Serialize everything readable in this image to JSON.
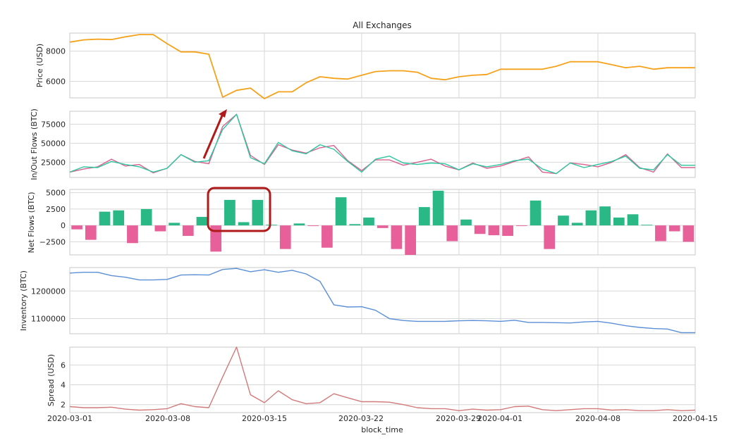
{
  "figure": {
    "title": "All Exchanges",
    "xlabel": "block_time",
    "x_ticks": [
      "2020-03-01",
      "2020-03-08",
      "2020-03-15",
      "2020-03-22",
      "2020-03-29",
      "2020-04-01",
      "2020-04-08",
      "2020-04-15"
    ],
    "colors": {
      "price": "#f5a21a",
      "inflow": "#d9608e",
      "outflow": "#2cc6a0",
      "net_positive": "#2ab887",
      "net_negative": "#e8609a",
      "inventory": "#5b8fd6",
      "spread": "#d17a7a",
      "annotation": "#b01a1a",
      "grid": "#d7d7d7"
    }
  },
  "chart_data": [
    {
      "type": "line",
      "ylabel": "Price (USD)",
      "ylim": [
        4900,
        9200
      ],
      "yticks": [
        6000,
        8000
      ],
      "ytick_labels": [
        "6000",
        "8000"
      ],
      "x": [
        "2020-03-01",
        "2020-03-02",
        "2020-03-03",
        "2020-03-04",
        "2020-03-05",
        "2020-03-06",
        "2020-03-07",
        "2020-03-08",
        "2020-03-09",
        "2020-03-10",
        "2020-03-11",
        "2020-03-12",
        "2020-03-13",
        "2020-03-14",
        "2020-03-15",
        "2020-03-16",
        "2020-03-17",
        "2020-03-18",
        "2020-03-19",
        "2020-03-20",
        "2020-03-21",
        "2020-03-22",
        "2020-03-23",
        "2020-03-24",
        "2020-03-25",
        "2020-03-26",
        "2020-03-27",
        "2020-03-28",
        "2020-03-29",
        "2020-03-30",
        "2020-03-31",
        "2020-04-01",
        "2020-04-02",
        "2020-04-03",
        "2020-04-04",
        "2020-04-05",
        "2020-04-06",
        "2020-04-07",
        "2020-04-08",
        "2020-04-09",
        "2020-04-10",
        "2020-04-11",
        "2020-04-12",
        "2020-04-13",
        "2020-04-14",
        "2020-04-15"
      ],
      "series": [
        {
          "values": [
            8600,
            8750,
            8800,
            8770,
            8950,
            9100,
            9100,
            8500,
            7950,
            7950,
            7800,
            4950,
            5400,
            5550,
            4850,
            5300,
            5300,
            5900,
            6300,
            6200,
            6150,
            6400,
            6650,
            6700,
            6700,
            6600,
            6200,
            6100,
            6300,
            6400,
            6450,
            6800,
            6800,
            6800,
            6800,
            7000,
            7300,
            7300,
            7300,
            7100,
            6900,
            7000,
            6800,
            6900,
            6900,
            6900
          ]
        }
      ]
    },
    {
      "type": "line",
      "ylabel": "In/Out Flows (BTC)",
      "ylim": [
        5000,
        92000
      ],
      "yticks": [
        25000,
        50000,
        75000
      ],
      "ytick_labels": [
        "25000",
        "50000",
        "75000"
      ],
      "x": [
        "2020-03-01",
        "2020-03-02",
        "2020-03-03",
        "2020-03-04",
        "2020-03-05",
        "2020-03-06",
        "2020-03-07",
        "2020-03-08",
        "2020-03-09",
        "2020-03-10",
        "2020-03-11",
        "2020-03-12",
        "2020-03-13",
        "2020-03-14",
        "2020-03-15",
        "2020-03-16",
        "2020-03-17",
        "2020-03-18",
        "2020-03-19",
        "2020-03-20",
        "2020-03-21",
        "2020-03-22",
        "2020-03-23",
        "2020-03-24",
        "2020-03-25",
        "2020-03-26",
        "2020-03-27",
        "2020-03-28",
        "2020-03-29",
        "2020-03-30",
        "2020-03-31",
        "2020-04-01",
        "2020-04-02",
        "2020-04-03",
        "2020-04-04",
        "2020-04-05",
        "2020-04-06",
        "2020-04-07",
        "2020-04-08",
        "2020-04-09",
        "2020-04-10",
        "2020-04-11",
        "2020-04-12",
        "2020-04-13",
        "2020-04-14",
        "2020-04-15"
      ],
      "series": [
        {
          "values": [
            12000,
            16000,
            19000,
            29000,
            20000,
            22000,
            11000,
            17000,
            35000,
            26000,
            23000,
            72000,
            88000,
            34000,
            22000,
            48000,
            41000,
            37000,
            44000,
            47000,
            27000,
            14000,
            28000,
            28000,
            21000,
            25000,
            29000,
            20000,
            15000,
            24000,
            17000,
            20000,
            26000,
            32000,
            12000,
            10000,
            24000,
            22000,
            19000,
            25000,
            35000,
            18000,
            12000,
            36000,
            18000,
            18000
          ]
        },
        {
          "values": [
            12000,
            19000,
            18000,
            26000,
            22000,
            19000,
            12000,
            17000,
            35000,
            25000,
            27000,
            68000,
            88000,
            31000,
            23000,
            51000,
            40000,
            36000,
            48000,
            42000,
            26000,
            12000,
            29000,
            33000,
            24000,
            22000,
            24000,
            23000,
            15000,
            23000,
            19000,
            22000,
            27000,
            29000,
            16000,
            10000,
            24000,
            18000,
            22000,
            26000,
            33000,
            17000,
            15000,
            35000,
            21000,
            21000
          ]
        }
      ]
    },
    {
      "type": "bar",
      "ylabel": "Net Flows (BTC)",
      "ylim": [
        -4500,
        5500
      ],
      "yticks": [
        -2500,
        0,
        2500,
        5000
      ],
      "ytick_labels": [
        "−2500",
        "0",
        "2500",
        "5000"
      ],
      "x": [
        "2020-03-01",
        "2020-03-02",
        "2020-03-03",
        "2020-03-04",
        "2020-03-05",
        "2020-03-06",
        "2020-03-07",
        "2020-03-08",
        "2020-03-09",
        "2020-03-10",
        "2020-03-11",
        "2020-03-12",
        "2020-03-13",
        "2020-03-14",
        "2020-03-15",
        "2020-03-16",
        "2020-03-17",
        "2020-03-18",
        "2020-03-19",
        "2020-03-20",
        "2020-03-21",
        "2020-03-22",
        "2020-03-23",
        "2020-03-24",
        "2020-03-25",
        "2020-03-26",
        "2020-03-27",
        "2020-03-28",
        "2020-03-29",
        "2020-03-30",
        "2020-03-31",
        "2020-04-01",
        "2020-04-02",
        "2020-04-03",
        "2020-04-04",
        "2020-04-05",
        "2020-04-06",
        "2020-04-07",
        "2020-04-08",
        "2020-04-09",
        "2020-04-10",
        "2020-04-11",
        "2020-04-12",
        "2020-04-13",
        "2020-04-14"
      ],
      "values": [
        -600,
        -2200,
        2100,
        2300,
        -2700,
        2500,
        -900,
        400,
        -1600,
        1300,
        -4000,
        3900,
        500,
        3900,
        100,
        -3600,
        300,
        -100,
        -3400,
        4300,
        200,
        1200,
        -400,
        -3600,
        -4500,
        2800,
        5300,
        -2400,
        900,
        -1300,
        -1500,
        -1600,
        -100,
        3800,
        -3600,
        1500,
        400,
        2300,
        2900,
        1200,
        1700,
        100,
        -2400,
        -900,
        -2500
      ]
    },
    {
      "type": "line",
      "ylabel": "Inventory (BTC)",
      "ylim": [
        1045000,
        1285000
      ],
      "yticks": [
        1100000,
        1200000
      ],
      "ytick_labels": [
        "1100000",
        "1200000"
      ],
      "x": [
        "2020-03-01",
        "2020-03-02",
        "2020-03-03",
        "2020-03-04",
        "2020-03-05",
        "2020-03-06",
        "2020-03-07",
        "2020-03-08",
        "2020-03-09",
        "2020-03-10",
        "2020-03-11",
        "2020-03-12",
        "2020-03-13",
        "2020-03-14",
        "2020-03-15",
        "2020-03-16",
        "2020-03-17",
        "2020-03-18",
        "2020-03-19",
        "2020-03-20",
        "2020-03-21",
        "2020-03-22",
        "2020-03-23",
        "2020-03-24",
        "2020-03-25",
        "2020-03-26",
        "2020-03-27",
        "2020-03-28",
        "2020-03-29",
        "2020-03-30",
        "2020-03-31",
        "2020-04-01",
        "2020-04-02",
        "2020-04-03",
        "2020-04-04",
        "2020-04-05",
        "2020-04-06",
        "2020-04-07",
        "2020-04-08",
        "2020-04-09",
        "2020-04-10",
        "2020-04-11",
        "2020-04-12",
        "2020-04-13",
        "2020-04-14",
        "2020-04-15"
      ],
      "series": [
        {
          "values": [
            1265000,
            1268000,
            1268000,
            1256000,
            1250000,
            1240000,
            1240000,
            1242000,
            1258000,
            1259000,
            1258000,
            1278000,
            1282000,
            1270000,
            1277000,
            1268000,
            1275000,
            1262000,
            1235000,
            1150000,
            1142000,
            1143000,
            1130000,
            1100000,
            1093000,
            1090000,
            1090000,
            1090000,
            1092000,
            1093000,
            1092000,
            1090000,
            1094000,
            1086000,
            1086000,
            1085000,
            1084000,
            1088000,
            1090000,
            1083000,
            1074000,
            1068000,
            1064000,
            1062000,
            1049000,
            1049000
          ]
        }
      ]
    },
    {
      "type": "line",
      "ylabel": "Spread (USD)",
      "ylim": [
        1.2,
        7.8
      ],
      "yticks": [
        2,
        4,
        6
      ],
      "ytick_labels": [
        "2",
        "4",
        "6"
      ],
      "x": [
        "2020-03-01",
        "2020-03-02",
        "2020-03-03",
        "2020-03-04",
        "2020-03-05",
        "2020-03-06",
        "2020-03-07",
        "2020-03-08",
        "2020-03-09",
        "2020-03-10",
        "2020-03-11",
        "2020-03-12",
        "2020-03-13",
        "2020-03-14",
        "2020-03-15",
        "2020-03-16",
        "2020-03-17",
        "2020-03-18",
        "2020-03-19",
        "2020-03-20",
        "2020-03-21",
        "2020-03-22",
        "2020-03-23",
        "2020-03-24",
        "2020-03-25",
        "2020-03-26",
        "2020-03-27",
        "2020-03-28",
        "2020-03-29",
        "2020-03-30",
        "2020-03-31",
        "2020-04-01",
        "2020-04-02",
        "2020-04-03",
        "2020-04-04",
        "2020-04-05",
        "2020-04-06",
        "2020-04-07",
        "2020-04-08",
        "2020-04-09",
        "2020-04-10",
        "2020-04-11",
        "2020-04-12",
        "2020-04-13",
        "2020-04-14",
        "2020-04-15"
      ],
      "series": [
        {
          "values": [
            1.8,
            1.7,
            1.7,
            1.75,
            1.55,
            1.45,
            1.5,
            1.6,
            2.1,
            1.8,
            1.7,
            4.8,
            7.8,
            3.0,
            2.2,
            3.4,
            2.5,
            2.1,
            2.2,
            3.1,
            2.7,
            2.3,
            2.3,
            2.25,
            2.0,
            1.7,
            1.6,
            1.6,
            1.4,
            1.55,
            1.45,
            1.5,
            1.8,
            1.85,
            1.5,
            1.4,
            1.5,
            1.6,
            1.6,
            1.45,
            1.5,
            1.4,
            1.4,
            1.5,
            1.4,
            1.45
          ]
        }
      ]
    }
  ]
}
